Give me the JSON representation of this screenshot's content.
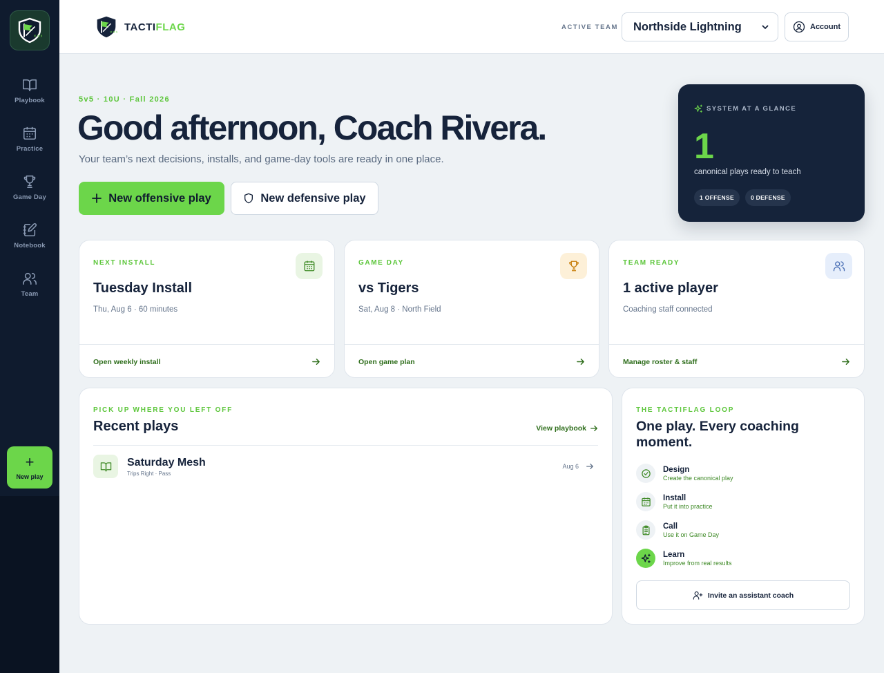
{
  "brand": {
    "name_part1": "TACTI",
    "name_part2": "FLAG"
  },
  "sidebar": {
    "items": [
      {
        "label": "Playbook",
        "icon": "book-open-icon"
      },
      {
        "label": "Practice",
        "icon": "calendar-icon"
      },
      {
        "label": "Game Day",
        "icon": "trophy-icon"
      },
      {
        "label": "Notebook",
        "icon": "notebook-pen-icon"
      },
      {
        "label": "Team",
        "icon": "users-icon"
      }
    ],
    "new_play_label": "New play"
  },
  "header": {
    "active_team_label": "ACTIVE TEAM",
    "active_team": "Northside Lightning",
    "account_label": "Account"
  },
  "hero": {
    "eyebrow": "5v5 · 10U · Fall 2026",
    "title": "Good afternoon, Coach Rivera.",
    "subtitle": "Your team’s next decisions, installs, and game-day tools are ready in one place.",
    "primary_button": "New offensive play",
    "secondary_button": "New defensive play"
  },
  "glance": {
    "heading": "SYSTEM AT A GLANCE",
    "count": "1",
    "caption": "canonical plays ready to teach",
    "pills": [
      "1 OFFENSE",
      "0 DEFENSE"
    ]
  },
  "cards": [
    {
      "eyebrow": "NEXT INSTALL",
      "title": "Tuesday Install",
      "subtitle": "Thu, Aug 6 · 60 minutes",
      "link": "Open weekly install",
      "icon": "calendar-icon",
      "icon_bg": "#e9f5e3",
      "icon_color": "#3f8a27"
    },
    {
      "eyebrow": "GAME DAY",
      "title": "vs Tigers",
      "subtitle": "Sat, Aug 8 · North Field",
      "link": "Open game plan",
      "icon": "trophy-icon",
      "icon_bg": "#fdf0d8",
      "icon_color": "#c77d0a"
    },
    {
      "eyebrow": "TEAM READY",
      "title": "1 active player",
      "subtitle": "Coaching staff connected",
      "link": "Manage roster & staff",
      "icon": "users-icon",
      "icon_bg": "#e6eefb",
      "icon_color": "#4a6fb5"
    }
  ],
  "recent": {
    "eyebrow": "PICK UP WHERE YOU LEFT OFF",
    "title": "Recent plays",
    "view_link": "View playbook",
    "plays": [
      {
        "name": "Saturday Mesh",
        "meta": "Trips Right · Pass",
        "date": "Aug 6"
      }
    ]
  },
  "loop": {
    "eyebrow": "THE TACTIFLAG LOOP",
    "title": "One play. Every coaching moment.",
    "steps": [
      {
        "name": "Design",
        "desc": "Create the canonical play",
        "icon": "check-circle-icon"
      },
      {
        "name": "Install",
        "desc": "Put it into practice",
        "icon": "calendar-icon"
      },
      {
        "name": "Call",
        "desc": "Use it on Game Day",
        "icon": "clipboard-icon"
      },
      {
        "name": "Learn",
        "desc": "Improve from real results",
        "icon": "sparkles-icon"
      }
    ],
    "invite_button": "Invite an assistant coach"
  },
  "colors": {
    "accent": "#6cd64a",
    "sidebar": "#0f1b2e",
    "navy_card": "#15233a",
    "link_green": "#2f6e1c"
  }
}
